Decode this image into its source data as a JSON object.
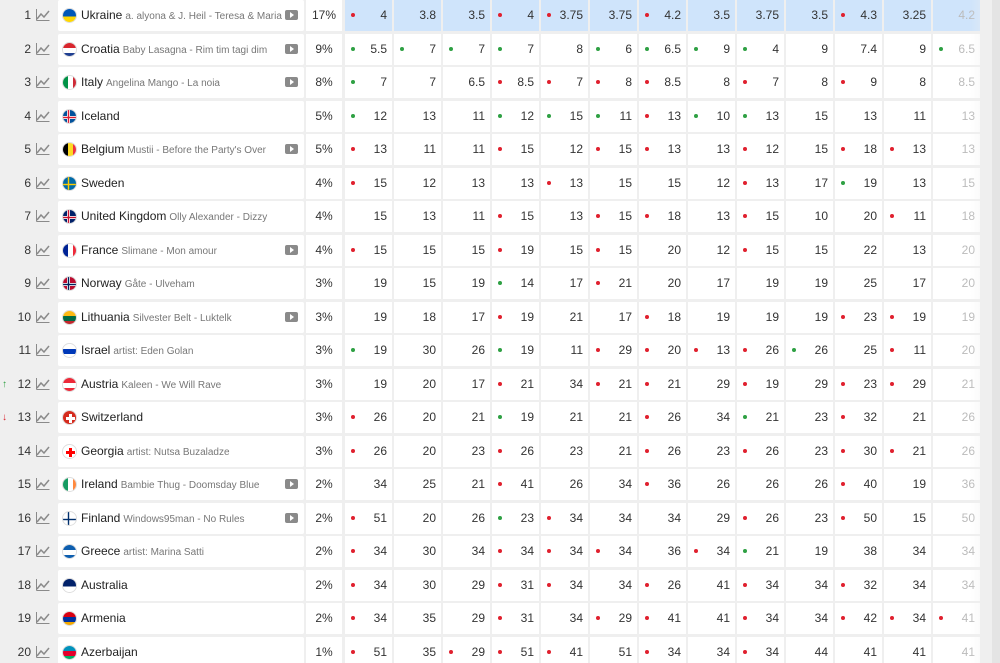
{
  "colors": {
    "rise": "#2ea043",
    "fall": "#e0202e",
    "highlight": "#cfe4fb"
  },
  "rows": [
    {
      "rank": "1",
      "move": "",
      "country": "Ukraine",
      "entry": "a. alyona & J. Heil - Teresa & Maria",
      "video": true,
      "pct": "17%",
      "flag": [
        "#0057b8",
        "#ffd700"
      ],
      "flagStyle": "h",
      "odds": [
        "4",
        "3.8",
        "3.5",
        "4",
        "3.75",
        "3.75",
        "4.2",
        "3.5",
        "3.75",
        "3.5",
        "4.3",
        "3.25",
        "4.2"
      ],
      "dots": [
        "r",
        "",
        "",
        "r",
        "r",
        "",
        "r",
        "",
        "",
        "",
        "r",
        "",
        ""
      ]
    },
    {
      "rank": "2",
      "move": "",
      "country": "Croatia",
      "entry": "Baby Lasagna - Rim tim tagi dim",
      "video": true,
      "pct": "9%",
      "flag": [
        "#d8262e",
        "#ffffff",
        "#1f3f91"
      ],
      "flagStyle": "h3",
      "odds": [
        "5.5",
        "7",
        "7",
        "7",
        "8",
        "6",
        "6.5",
        "9",
        "4",
        "9",
        "7.4",
        "9",
        "6.5"
      ],
      "dots": [
        "g",
        "g",
        "g",
        "g",
        "",
        "g",
        "g",
        "g",
        "g",
        "",
        "",
        "",
        "g"
      ]
    },
    {
      "rank": "3",
      "move": "",
      "country": "Italy",
      "entry": "Angelina Mango - La noia",
      "video": true,
      "pct": "8%",
      "flag": [
        "#009246",
        "#ffffff",
        "#ce2b37"
      ],
      "flagStyle": "v3",
      "odds": [
        "7",
        "7",
        "6.5",
        "8.5",
        "7",
        "8",
        "8.5",
        "8",
        "7",
        "8",
        "9",
        "8",
        "8.5"
      ],
      "dots": [
        "g",
        "",
        "",
        "r",
        "r",
        "r",
        "r",
        "",
        "r",
        "",
        "r",
        "",
        ""
      ]
    },
    {
      "rank": "4",
      "move": "",
      "country": "Iceland",
      "entry": "",
      "video": false,
      "pct": "5%",
      "flag": [
        "#02529c",
        "#dc1e35",
        "#ffffff"
      ],
      "flagStyle": "cross",
      "odds": [
        "12",
        "13",
        "11",
        "12",
        "15",
        "11",
        "13",
        "10",
        "13",
        "15",
        "13",
        "11",
        "13"
      ],
      "dots": [
        "g",
        "",
        "",
        "g",
        "g",
        "g",
        "r",
        "g",
        "g",
        "",
        "",
        "",
        ""
      ]
    },
    {
      "rank": "5",
      "move": "",
      "country": "Belgium",
      "entry": "Mustii - Before the Party's Over",
      "video": true,
      "pct": "5%",
      "flag": [
        "#000000",
        "#fdda24",
        "#ef3340"
      ],
      "flagStyle": "v3",
      "odds": [
        "13",
        "11",
        "11",
        "15",
        "12",
        "15",
        "13",
        "13",
        "12",
        "15",
        "18",
        "13",
        "13"
      ],
      "dots": [
        "r",
        "",
        "",
        "r",
        "",
        "r",
        "r",
        "",
        "r",
        "",
        "r",
        "r",
        ""
      ]
    },
    {
      "rank": "6",
      "move": "",
      "country": "Sweden",
      "entry": "",
      "video": false,
      "pct": "4%",
      "flag": [
        "#006aa7",
        "#fecc02",
        "#006aa7"
      ],
      "flagStyle": "cross",
      "odds": [
        "15",
        "12",
        "13",
        "13",
        "13",
        "15",
        "15",
        "12",
        "13",
        "17",
        "19",
        "13",
        "15"
      ],
      "dots": [
        "r",
        "",
        "",
        "",
        "r",
        "",
        "",
        "",
        "r",
        "",
        "g",
        "",
        ""
      ]
    },
    {
      "rank": "7",
      "move": "",
      "country": "United Kingdom",
      "entry": "Olly Alexander - Dizzy",
      "video": false,
      "pct": "4%",
      "flag": [
        "#012169",
        "#c8102e",
        "#ffffff"
      ],
      "flagStyle": "cross",
      "odds": [
        "15",
        "13",
        "11",
        "15",
        "13",
        "15",
        "18",
        "13",
        "15",
        "10",
        "20",
        "11",
        "18"
      ],
      "dots": [
        "",
        "",
        "",
        "r",
        "",
        "r",
        "r",
        "",
        "r",
        "",
        "",
        "r",
        ""
      ]
    },
    {
      "rank": "8",
      "move": "",
      "country": "France",
      "entry": "Slimane - Mon amour",
      "video": true,
      "pct": "4%",
      "flag": [
        "#002395",
        "#ffffff",
        "#ed2939"
      ],
      "flagStyle": "v3",
      "odds": [
        "15",
        "15",
        "15",
        "19",
        "15",
        "15",
        "20",
        "12",
        "15",
        "15",
        "22",
        "13",
        "20"
      ],
      "dots": [
        "r",
        "",
        "",
        "r",
        "",
        "r",
        "",
        "",
        "r",
        "",
        "",
        "",
        ""
      ]
    },
    {
      "rank": "9",
      "move": "",
      "country": "Norway",
      "entry": "Gåte - Ulveham",
      "video": false,
      "pct": "3%",
      "flag": [
        "#ba0c2f",
        "#00205b",
        "#ffffff"
      ],
      "flagStyle": "cross",
      "odds": [
        "19",
        "15",
        "19",
        "14",
        "17",
        "21",
        "20",
        "17",
        "19",
        "19",
        "25",
        "17",
        "20"
      ],
      "dots": [
        "",
        "",
        "",
        "g",
        "",
        "r",
        "",
        "",
        "",
        "",
        "",
        "",
        ""
      ]
    },
    {
      "rank": "10",
      "move": "",
      "country": "Lithuania",
      "entry": "Silvester Belt - Luktelk",
      "video": true,
      "pct": "3%",
      "flag": [
        "#fdb913",
        "#006a44",
        "#c1272d"
      ],
      "flagStyle": "h3",
      "odds": [
        "19",
        "18",
        "17",
        "19",
        "21",
        "17",
        "18",
        "19",
        "19",
        "19",
        "23",
        "19",
        "19"
      ],
      "dots": [
        "",
        "",
        "",
        "r",
        "",
        "",
        "r",
        "",
        "",
        "",
        "r",
        "r",
        ""
      ]
    },
    {
      "rank": "11",
      "move": "",
      "country": "Israel",
      "entry": "artist: Eden Golan",
      "video": false,
      "pct": "3%",
      "flag": [
        "#ffffff",
        "#0038b8",
        "#ffffff"
      ],
      "flagStyle": "h3",
      "odds": [
        "19",
        "30",
        "26",
        "19",
        "11",
        "29",
        "20",
        "13",
        "26",
        "26",
        "25",
        "11",
        "20"
      ],
      "dots": [
        "g",
        "",
        "",
        "g",
        "",
        "r",
        "r",
        "r",
        "r",
        "g",
        "",
        "r",
        ""
      ]
    },
    {
      "rank": "12",
      "move": "up",
      "country": "Austria",
      "entry": "Kaleen - We Will Rave",
      "video": false,
      "pct": "3%",
      "flag": [
        "#ed2939",
        "#ffffff",
        "#ed2939"
      ],
      "flagStyle": "h3",
      "odds": [
        "19",
        "20",
        "17",
        "21",
        "34",
        "21",
        "21",
        "29",
        "19",
        "29",
        "23",
        "29",
        "21"
      ],
      "dots": [
        "",
        "",
        "",
        "r",
        "",
        "r",
        "r",
        "",
        "r",
        "",
        "r",
        "r",
        ""
      ]
    },
    {
      "rank": "13",
      "move": "down",
      "country": "Switzerland",
      "entry": "",
      "video": false,
      "pct": "3%",
      "flag": [
        "#d52b1e",
        "#ffffff",
        "#d52b1e"
      ],
      "flagStyle": "swiss",
      "odds": [
        "26",
        "20",
        "21",
        "19",
        "21",
        "21",
        "26",
        "34",
        "21",
        "23",
        "32",
        "21",
        "26"
      ],
      "dots": [
        "r",
        "",
        "",
        "g",
        "",
        "",
        "r",
        "",
        "g",
        "",
        "r",
        "",
        ""
      ]
    },
    {
      "rank": "14",
      "move": "",
      "country": "Georgia",
      "entry": "artist: Nutsa Buzaladze",
      "video": false,
      "pct": "3%",
      "flag": [
        "#ffffff",
        "#ff0000",
        "#ffffff"
      ],
      "flagStyle": "swiss",
      "odds": [
        "26",
        "20",
        "23",
        "26",
        "23",
        "21",
        "26",
        "23",
        "26",
        "23",
        "30",
        "21",
        "26"
      ],
      "dots": [
        "r",
        "",
        "",
        "r",
        "",
        "",
        "r",
        "",
        "r",
        "",
        "r",
        "r",
        ""
      ]
    },
    {
      "rank": "15",
      "move": "",
      "country": "Ireland",
      "entry": "Bambie Thug - Doomsday Blue",
      "video": true,
      "pct": "2%",
      "flag": [
        "#169b62",
        "#ffffff",
        "#ff883e"
      ],
      "flagStyle": "v3",
      "odds": [
        "34",
        "25",
        "21",
        "41",
        "26",
        "34",
        "36",
        "26",
        "26",
        "26",
        "40",
        "19",
        "36"
      ],
      "dots": [
        "",
        "",
        "",
        "r",
        "",
        "",
        "r",
        "",
        "",
        "",
        "r",
        "",
        ""
      ]
    },
    {
      "rank": "16",
      "move": "",
      "country": "Finland",
      "entry": "Windows95man - No Rules",
      "video": true,
      "pct": "2%",
      "flag": [
        "#ffffff",
        "#002f6c",
        "#ffffff"
      ],
      "flagStyle": "cross",
      "odds": [
        "51",
        "20",
        "26",
        "23",
        "34",
        "34",
        "34",
        "29",
        "26",
        "23",
        "50",
        "15",
        "50"
      ],
      "dots": [
        "r",
        "",
        "",
        "g",
        "r",
        "",
        "",
        "",
        "r",
        "",
        "r",
        "",
        ""
      ]
    },
    {
      "rank": "17",
      "move": "",
      "country": "Greece",
      "entry": "artist: Marina Satti",
      "video": false,
      "pct": "2%",
      "flag": [
        "#0d5eaf",
        "#ffffff",
        "#0d5eaf"
      ],
      "flagStyle": "h3",
      "odds": [
        "34",
        "30",
        "34",
        "34",
        "34",
        "34",
        "36",
        "34",
        "21",
        "19",
        "38",
        "34",
        "34"
      ],
      "dots": [
        "r",
        "",
        "",
        "r",
        "r",
        "r",
        "",
        "r",
        "g",
        "",
        "",
        "",
        ""
      ]
    },
    {
      "rank": "18",
      "move": "",
      "country": "Australia",
      "entry": "",
      "video": false,
      "pct": "2%",
      "flag": [
        "#012169",
        "#ffffff",
        "#e4002b"
      ],
      "flagStyle": "h",
      "odds": [
        "34",
        "30",
        "29",
        "31",
        "34",
        "34",
        "26",
        "41",
        "34",
        "34",
        "32",
        "34",
        "34"
      ],
      "dots": [
        "r",
        "",
        "",
        "r",
        "r",
        "",
        "r",
        "",
        "r",
        "",
        "r",
        "",
        ""
      ]
    },
    {
      "rank": "19",
      "move": "",
      "country": "Armenia",
      "entry": "",
      "video": false,
      "pct": "2%",
      "flag": [
        "#d90012",
        "#0033a0",
        "#f2a800"
      ],
      "flagStyle": "h3",
      "odds": [
        "34",
        "35",
        "29",
        "31",
        "34",
        "29",
        "41",
        "41",
        "34",
        "34",
        "42",
        "34",
        "41"
      ],
      "dots": [
        "r",
        "",
        "",
        "r",
        "",
        "r",
        "r",
        "",
        "r",
        "",
        "r",
        "r",
        "r"
      ]
    },
    {
      "rank": "20",
      "move": "",
      "country": "Azerbaijan",
      "entry": "",
      "video": false,
      "pct": "1%",
      "flag": [
        "#0092bc",
        "#e4002b",
        "#00af66"
      ],
      "flagStyle": "h3",
      "odds": [
        "51",
        "35",
        "29",
        "51",
        "41",
        "51",
        "34",
        "34",
        "34",
        "44",
        "41",
        "41",
        "41"
      ],
      "dots": [
        "r",
        "",
        "r",
        "r",
        "r",
        "",
        "r",
        "",
        "r",
        "",
        "",
        "",
        ""
      ]
    }
  ]
}
